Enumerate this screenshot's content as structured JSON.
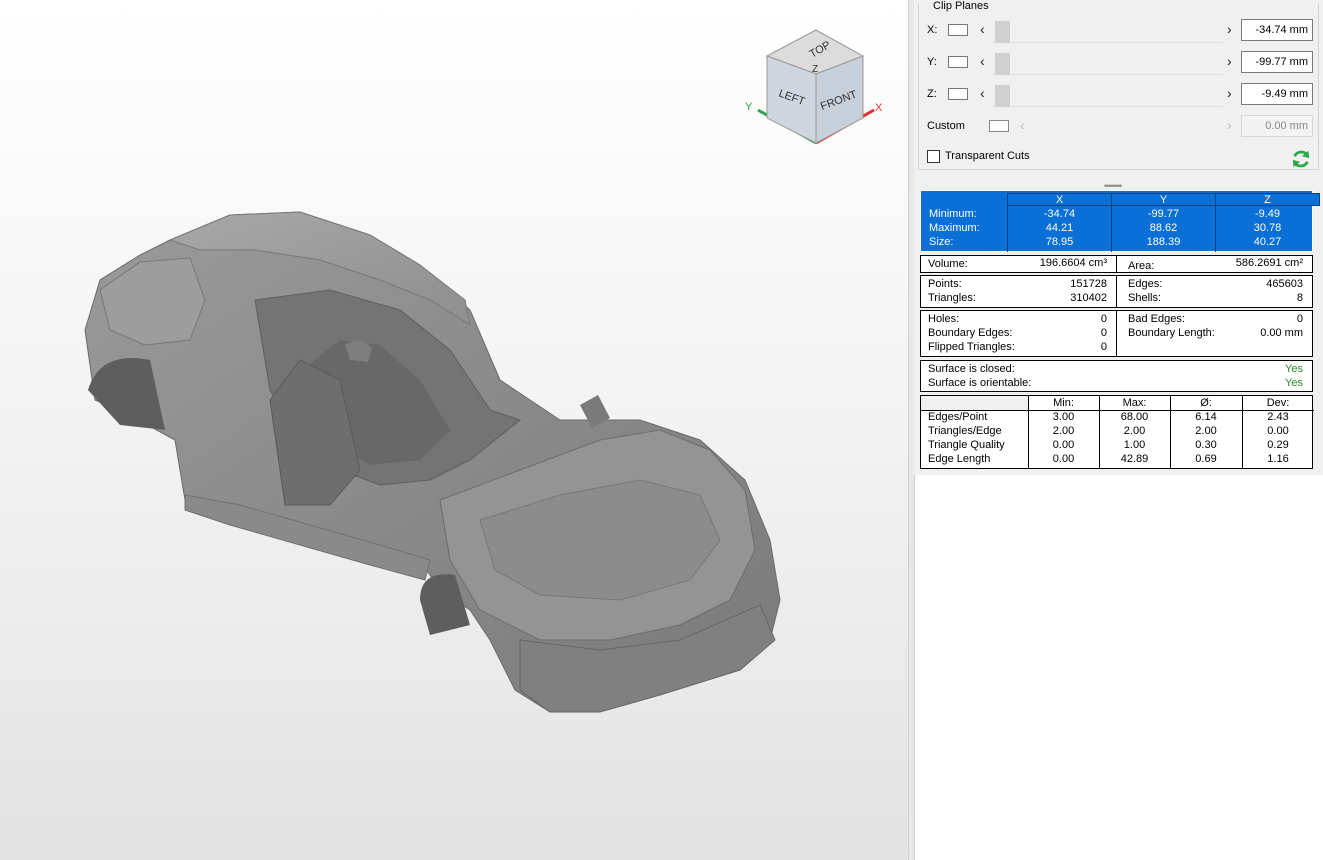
{
  "viewcube": {
    "face_top": "TOP",
    "face_left": "LEFT",
    "face_front": "FRONT",
    "axis_x": "X",
    "axis_y": "Y",
    "axis_z": "Z"
  },
  "clip_planes": {
    "title": "Clip Planes",
    "rows": [
      {
        "label": "X:",
        "value": "-34.74 mm"
      },
      {
        "label": "Y:",
        "value": "-99.77 mm"
      },
      {
        "label": "Z:",
        "value": "-9.49 mm"
      },
      {
        "label": "Custom",
        "value": "0.00 mm"
      }
    ],
    "arrow_left": "‹",
    "arrow_right": "›",
    "transparent_cuts": "Transparent Cuts"
  },
  "bounding_box": {
    "columns": [
      "X",
      "Y",
      "Z"
    ],
    "rows": [
      {
        "label": "Minimum:",
        "values": [
          "-34.74",
          "-99.77",
          "-9.49"
        ]
      },
      {
        "label": "Maximum:",
        "values": [
          "44.21",
          "88.62",
          "30.78"
        ]
      },
      {
        "label": "Size:",
        "values": [
          "78.95",
          "188.39",
          "40.27"
        ]
      }
    ]
  },
  "measures": {
    "volume_label": "Volume:",
    "volume_value": "196.6604 cm³",
    "area_label": "Area:",
    "area_value": "586.2691 cm²",
    "points_label": "Points:",
    "points_value": "151728",
    "triangles_label": "Triangles:",
    "triangles_value": "310402",
    "edges_label": "Edges:",
    "edges_value": "465603",
    "shells_label": "Shells:",
    "shells_value": "8",
    "holes_label": "Holes:",
    "holes_value": "0",
    "boundary_edges_label": "Boundary Edges:",
    "boundary_edges_value": "0",
    "flipped_label": "Flipped Triangles:",
    "flipped_value": "0",
    "bad_edges_label": "Bad Edges:",
    "bad_edges_value": "0",
    "boundary_length_label": "Boundary Length:",
    "boundary_length_value": "0.00 mm",
    "closed_label": "Surface is closed:",
    "closed_value": "Yes",
    "orientable_label": "Surface is orientable:",
    "orientable_value": "Yes"
  },
  "stats": {
    "headers": [
      "Min:",
      "Max:",
      "Ø:",
      "Dev:"
    ],
    "rows": [
      {
        "label": "Edges/Point",
        "values": [
          "3.00",
          "68.00",
          "6.14",
          "2.43"
        ]
      },
      {
        "label": "Triangles/Edge",
        "values": [
          "2.00",
          "2.00",
          "2.00",
          "0.00"
        ]
      },
      {
        "label": "Triangle Quality",
        "values": [
          "0.00",
          "1.00",
          "0.30",
          "0.29"
        ]
      },
      {
        "label": "Edge Length",
        "values": [
          "0.00",
          "42.89",
          "0.69",
          "1.16"
        ]
      }
    ]
  },
  "colors": {
    "accent_blue": "#0a6fd6",
    "yes_green": "#2a8a2a",
    "axis_x": "#e03030",
    "axis_y": "#2aa84a",
    "axis_z": "#1a5fd0"
  }
}
